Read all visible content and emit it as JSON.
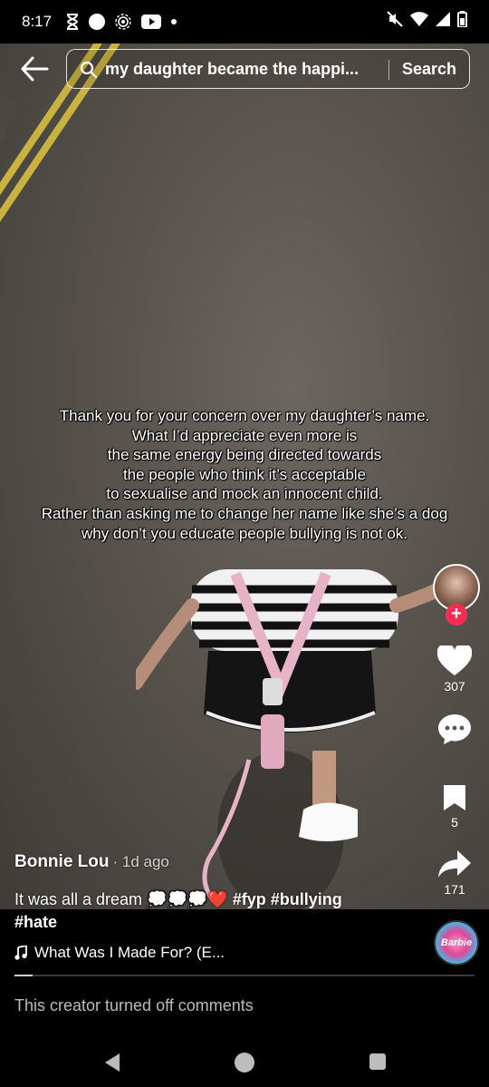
{
  "status_bar": {
    "time": "8:17",
    "left_icons": [
      "hourglass-icon",
      "circle-icon",
      "hotspot-icon",
      "youtube-icon",
      "dot-icon"
    ],
    "right_icons": [
      "mute-icon",
      "wifi-icon",
      "signal-icon",
      "battery-icon"
    ]
  },
  "search": {
    "query": "my daughter became the happi...",
    "button_label": "Search"
  },
  "caption": {
    "lines": [
      "Thank you for your concern over my daughter’s name.",
      "What I’d appreciate even more is",
      "the same energy being directed towards",
      "the people who think it’s acceptable",
      "to sexualise and mock an innocent child.",
      "Rather than asking me to change her name like she’s a dog",
      "why don’t you educate people bullying is not ok."
    ]
  },
  "actions": {
    "like_count": "307",
    "comment_icon": "comment-icon",
    "bookmark_count": "5",
    "share_count": "171",
    "follow_label": "+"
  },
  "post": {
    "author": "Bonnie Lou",
    "time": "· 1d ago",
    "description_text": "It was all a dream",
    "description_emoji": "💭💭💭❤️",
    "description_tags": "#fyp #bullying",
    "hashtag_line": "#hate",
    "music": "What Was I Made For? (E...",
    "disc_label": "Barbie"
  },
  "playback": {
    "progress_fraction": 0.04
  },
  "footer": {
    "comments_off": "This creator turned off comments"
  },
  "colors": {
    "accent": "#fe2c55",
    "background": "#000000"
  }
}
